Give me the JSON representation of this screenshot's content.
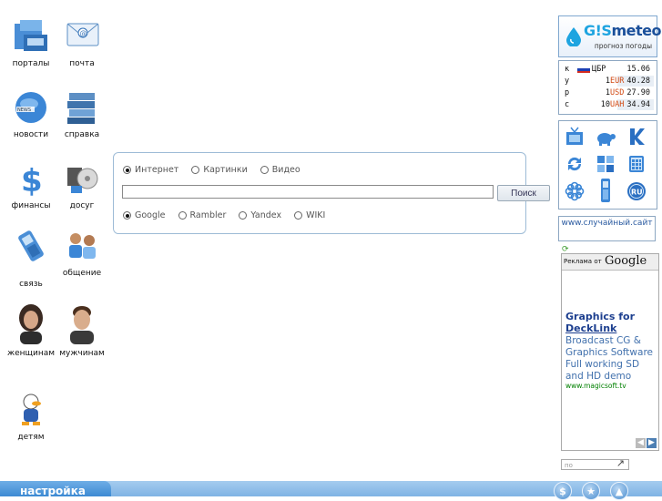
{
  "left_icons": [
    {
      "label": "порталы",
      "icon": "portals-icon"
    },
    {
      "label": "почта",
      "icon": "mail-icon"
    },
    {
      "label": "новости",
      "icon": "news-globe-icon"
    },
    {
      "label": "справка",
      "icon": "books-icon"
    },
    {
      "label": "финансы",
      "icon": "dollar-icon"
    },
    {
      "label": "досуг",
      "icon": "leisure-icon"
    },
    {
      "label": "связь",
      "icon": "phone-icon"
    },
    {
      "label": "общение",
      "icon": "people-icon"
    },
    {
      "label": "женщинам",
      "icon": "woman-icon"
    },
    {
      "label": "мужчинам",
      "icon": "man-icon"
    },
    {
      "label": "детям",
      "icon": "donald-duck-icon"
    }
  ],
  "search": {
    "type_options": [
      "Интернет",
      "Картинки",
      "Видео"
    ],
    "type_selected": "Интернет",
    "engine_options": [
      "Google",
      "Rambler",
      "Yandex",
      "WIKI"
    ],
    "engine_selected": "Google",
    "query": "",
    "button_label": "Поиск"
  },
  "gismeteo": {
    "title_prefix": "G!S",
    "title_rest": "meteo",
    "subtitle": "прогноз погоды"
  },
  "rates": {
    "side_letters": [
      "к",
      "у",
      "р",
      "с"
    ],
    "bank": "ЦБР",
    "bank_value": "15.06",
    "rows": [
      {
        "amount": "1",
        "currency": "EUR",
        "value": "40.28"
      },
      {
        "amount": "1",
        "currency": "USD",
        "value": "27.90"
      },
      {
        "amount": "10",
        "currency": "UAH",
        "value": "34.94"
      }
    ]
  },
  "services": [
    "tv-icon",
    "turtle-icon",
    "k-icon",
    "refresh-icon",
    "windows-icon",
    "calculator-icon",
    "flower-icon",
    "mobile-phone-icon",
    "ru-globe-icon"
  ],
  "random_link": "www.случайный.сайт",
  "ad": {
    "header_small": "Реклама от",
    "header_brand": "Google",
    "title_line1": "Graphics for",
    "title_line2": "DeckLink",
    "text": "Broadcast CG & Graphics Software Full working SD and HD demo",
    "url": "www.magicsoft.tv",
    "small_box_text": "по"
  },
  "bottom": {
    "settings_label": "настройка",
    "buttons": [
      "$",
      "★",
      "▲"
    ]
  },
  "colors": {
    "accent": "#3d8ad3",
    "bar": "#a5ccef",
    "currency": "#d24a14",
    "ad_title": "#1d3f8f",
    "ad_url": "#008000"
  }
}
